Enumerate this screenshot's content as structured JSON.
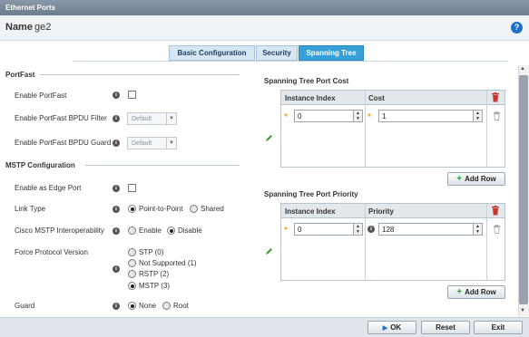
{
  "window": {
    "title": "Ethernet Ports"
  },
  "header": {
    "name_label": "Name",
    "name_value": "ge2"
  },
  "tabs": [
    {
      "label": "Basic Configuration",
      "active": false
    },
    {
      "label": "Security",
      "active": false
    },
    {
      "label": "Spanning Tree",
      "active": true
    }
  ],
  "portfast": {
    "title": "PortFast",
    "enable_portfast": {
      "label": "Enable PortFast",
      "checked": false
    },
    "bpdu_filter": {
      "label": "Enable PortFast BPDU Filter",
      "value": "Default"
    },
    "bpdu_guard": {
      "label": "Enable PortFast BPDU Guard",
      "value": "Default"
    }
  },
  "mstp": {
    "title": "MSTP Configuration",
    "edge_port": {
      "label": "Enable as Edge Port",
      "checked": false
    },
    "link_type": {
      "label": "Link Type",
      "options": [
        "Point-to-Point",
        "Shared"
      ],
      "selected": "Point-to-Point"
    },
    "cisco": {
      "label": "Cisco MSTP Interoperability",
      "options": [
        "Enable",
        "Disable"
      ],
      "selected": "Disable"
    },
    "force_protocol": {
      "label": "Force Protocol Version",
      "options": [
        "STP (0)",
        "Not Supported (1)",
        "RSTP (2)",
        "MSTP (3)"
      ],
      "selected": "MSTP (3)"
    },
    "guard": {
      "label": "Guard",
      "options": [
        "None",
        "Root"
      ],
      "selected": "None"
    }
  },
  "port_cost": {
    "title": "Spanning Tree Port Cost",
    "col_instance": "Instance Index",
    "col_value": "Cost",
    "rows": [
      {
        "instance": "0",
        "value": "1"
      }
    ],
    "add_row": "Add Row"
  },
  "port_priority": {
    "title": "Spanning Tree Port Priority",
    "col_instance": "Instance Index",
    "col_value": "Priority",
    "rows": [
      {
        "instance": "0",
        "value": "128"
      }
    ],
    "add_row": "Add Row"
  },
  "footer": {
    "ok": "OK",
    "reset": "Reset",
    "exit": "Exit"
  },
  "icons": {
    "info": "i",
    "help": "?",
    "plus": "+",
    "up": "▲",
    "down": "▼",
    "star": "*"
  }
}
